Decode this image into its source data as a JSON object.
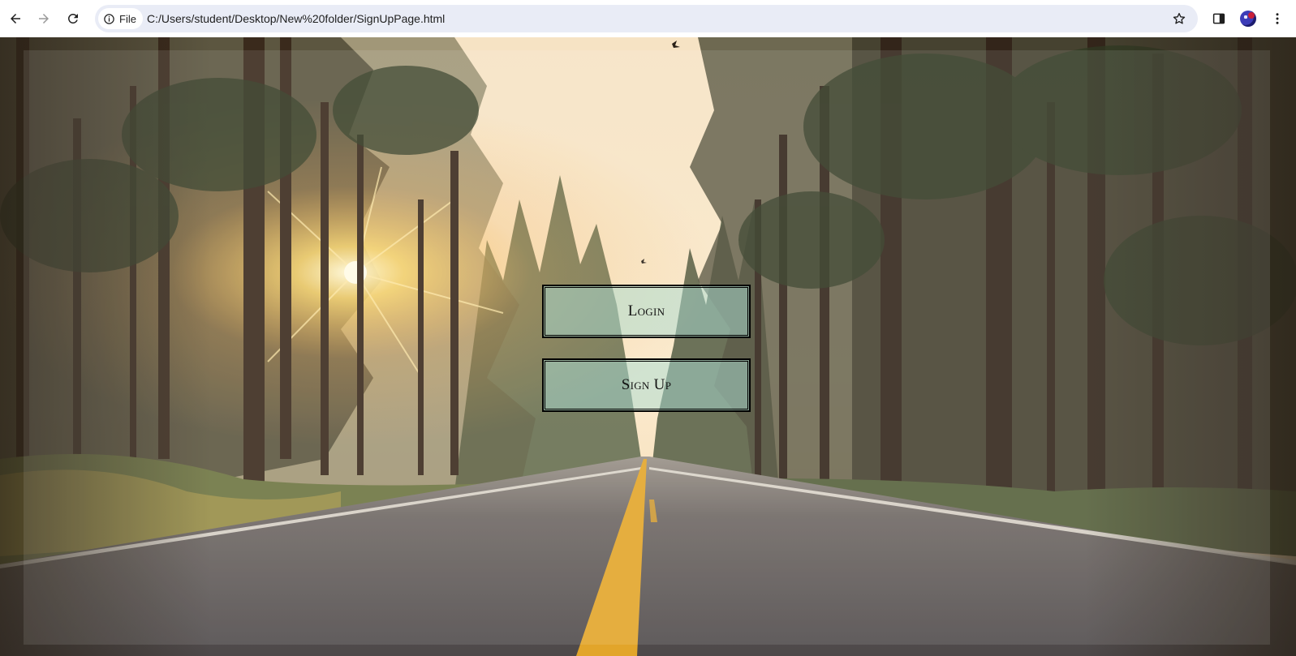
{
  "browser": {
    "site_chip_label": "File",
    "url": "C:/Users/student/Desktop/New%20folder/SignUpPage.html",
    "icons": {
      "back": "arrow-left-icon",
      "forward": "arrow-right-icon",
      "reload": "reload-icon",
      "site_info": "info-circle-icon",
      "bookmark": "star-outline-icon",
      "side_panel": "side-panel-icon",
      "profile": "avatar",
      "menu": "kebab-menu-icon"
    },
    "forward_enabled": false
  },
  "page": {
    "background": "forest road at sunset photo",
    "buttons": {
      "login_label": "Login",
      "signup_label": "Sign Up"
    },
    "colors": {
      "button_fill": "#aadcd2",
      "button_border": "#000000"
    }
  }
}
